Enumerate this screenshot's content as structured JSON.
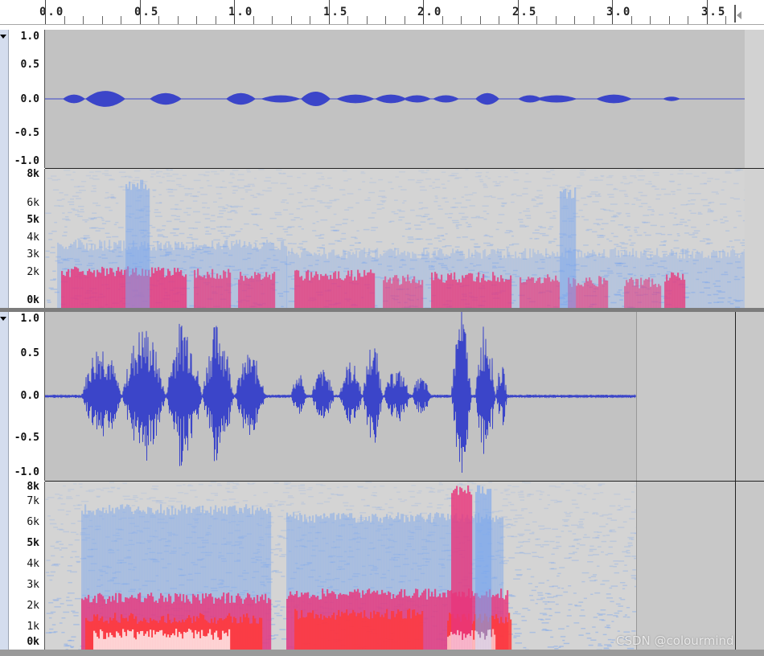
{
  "timeline": {
    "labels": [
      "0.0",
      "0.5",
      "1.0",
      "1.5",
      "2.0",
      "2.5",
      "3.0",
      "3.5"
    ]
  },
  "track1": {
    "waveform_scale": [
      "1.0",
      "0.5",
      "0.0",
      "-0.5",
      "-1.0"
    ],
    "spectrogram_scale": [
      "8k",
      "6k",
      "5k",
      "4k",
      "3k",
      "2k",
      "0k"
    ]
  },
  "track2": {
    "waveform_scale": [
      "1.0",
      "0.5",
      "0.0",
      "-0.5",
      "-1.0"
    ],
    "spectrogram_scale": [
      "8k",
      "7k",
      "6k",
      "5k",
      "4k",
      "3k",
      "2k",
      "1k",
      "0k"
    ]
  },
  "colors": {
    "waveform": "#3b45c9",
    "spectro_low": "#7aa6ee",
    "spectro_mid": "#e8357a",
    "spectro_high": "#ff3a3a"
  },
  "watermark": "CSDN @colourmind"
}
